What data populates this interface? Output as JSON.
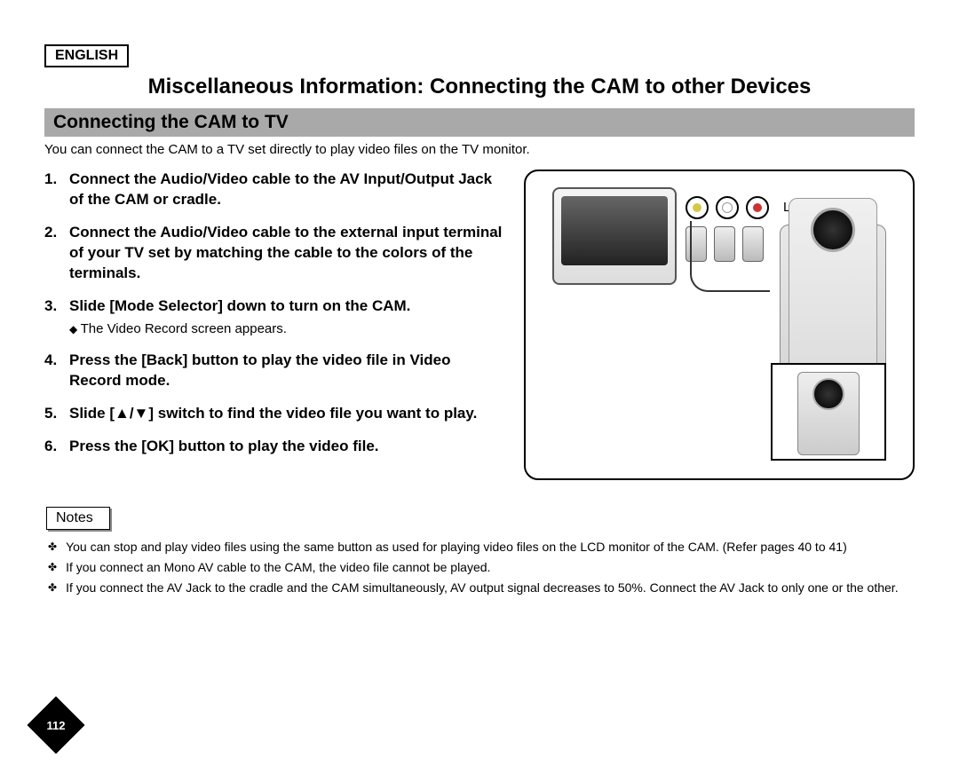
{
  "language_label": "ENGLISH",
  "main_title": "Miscellaneous Information: Connecting the CAM to other Devices",
  "subtitle": "Connecting the CAM to TV",
  "intro": "You can connect the CAM to a TV set directly to play video files on the TV monitor.",
  "steps": [
    {
      "num": "1.",
      "bold": "Connect the Audio/Video cable to the AV Input/Output Jack of the CAM or cradle.",
      "sub": ""
    },
    {
      "num": "2.",
      "bold": "Connect the Audio/Video cable to the external input terminal of your TV set by matching the cable to the colors of the terminals.",
      "sub": ""
    },
    {
      "num": "3.",
      "bold": "Slide [Mode Selector] down to turn on the CAM.",
      "sub": "The Video Record screen appears."
    },
    {
      "num": "4.",
      "bold": "Press the [Back] button to play the video file in Video Record mode.",
      "sub": ""
    },
    {
      "num": "5.",
      "bold": "Slide [▲/▼] switch to find the video file you want to play.",
      "sub": ""
    },
    {
      "num": "6.",
      "bold": "Press the [OK] button to play the video file.",
      "sub": ""
    }
  ],
  "diagram": {
    "line_input_label": "Line Input"
  },
  "notes_label": "Notes",
  "notes": [
    "You can stop and play video files using the same button as used for playing video files on the LCD monitor of the CAM. (Refer pages 40 to 41)",
    "If you connect an Mono AV cable to the CAM, the video file cannot be played.",
    "If you connect the AV Jack to the cradle and the CAM simultaneously, AV output signal decreases to 50%. Connect the AV Jack to only one or the other."
  ],
  "page_number": "112"
}
